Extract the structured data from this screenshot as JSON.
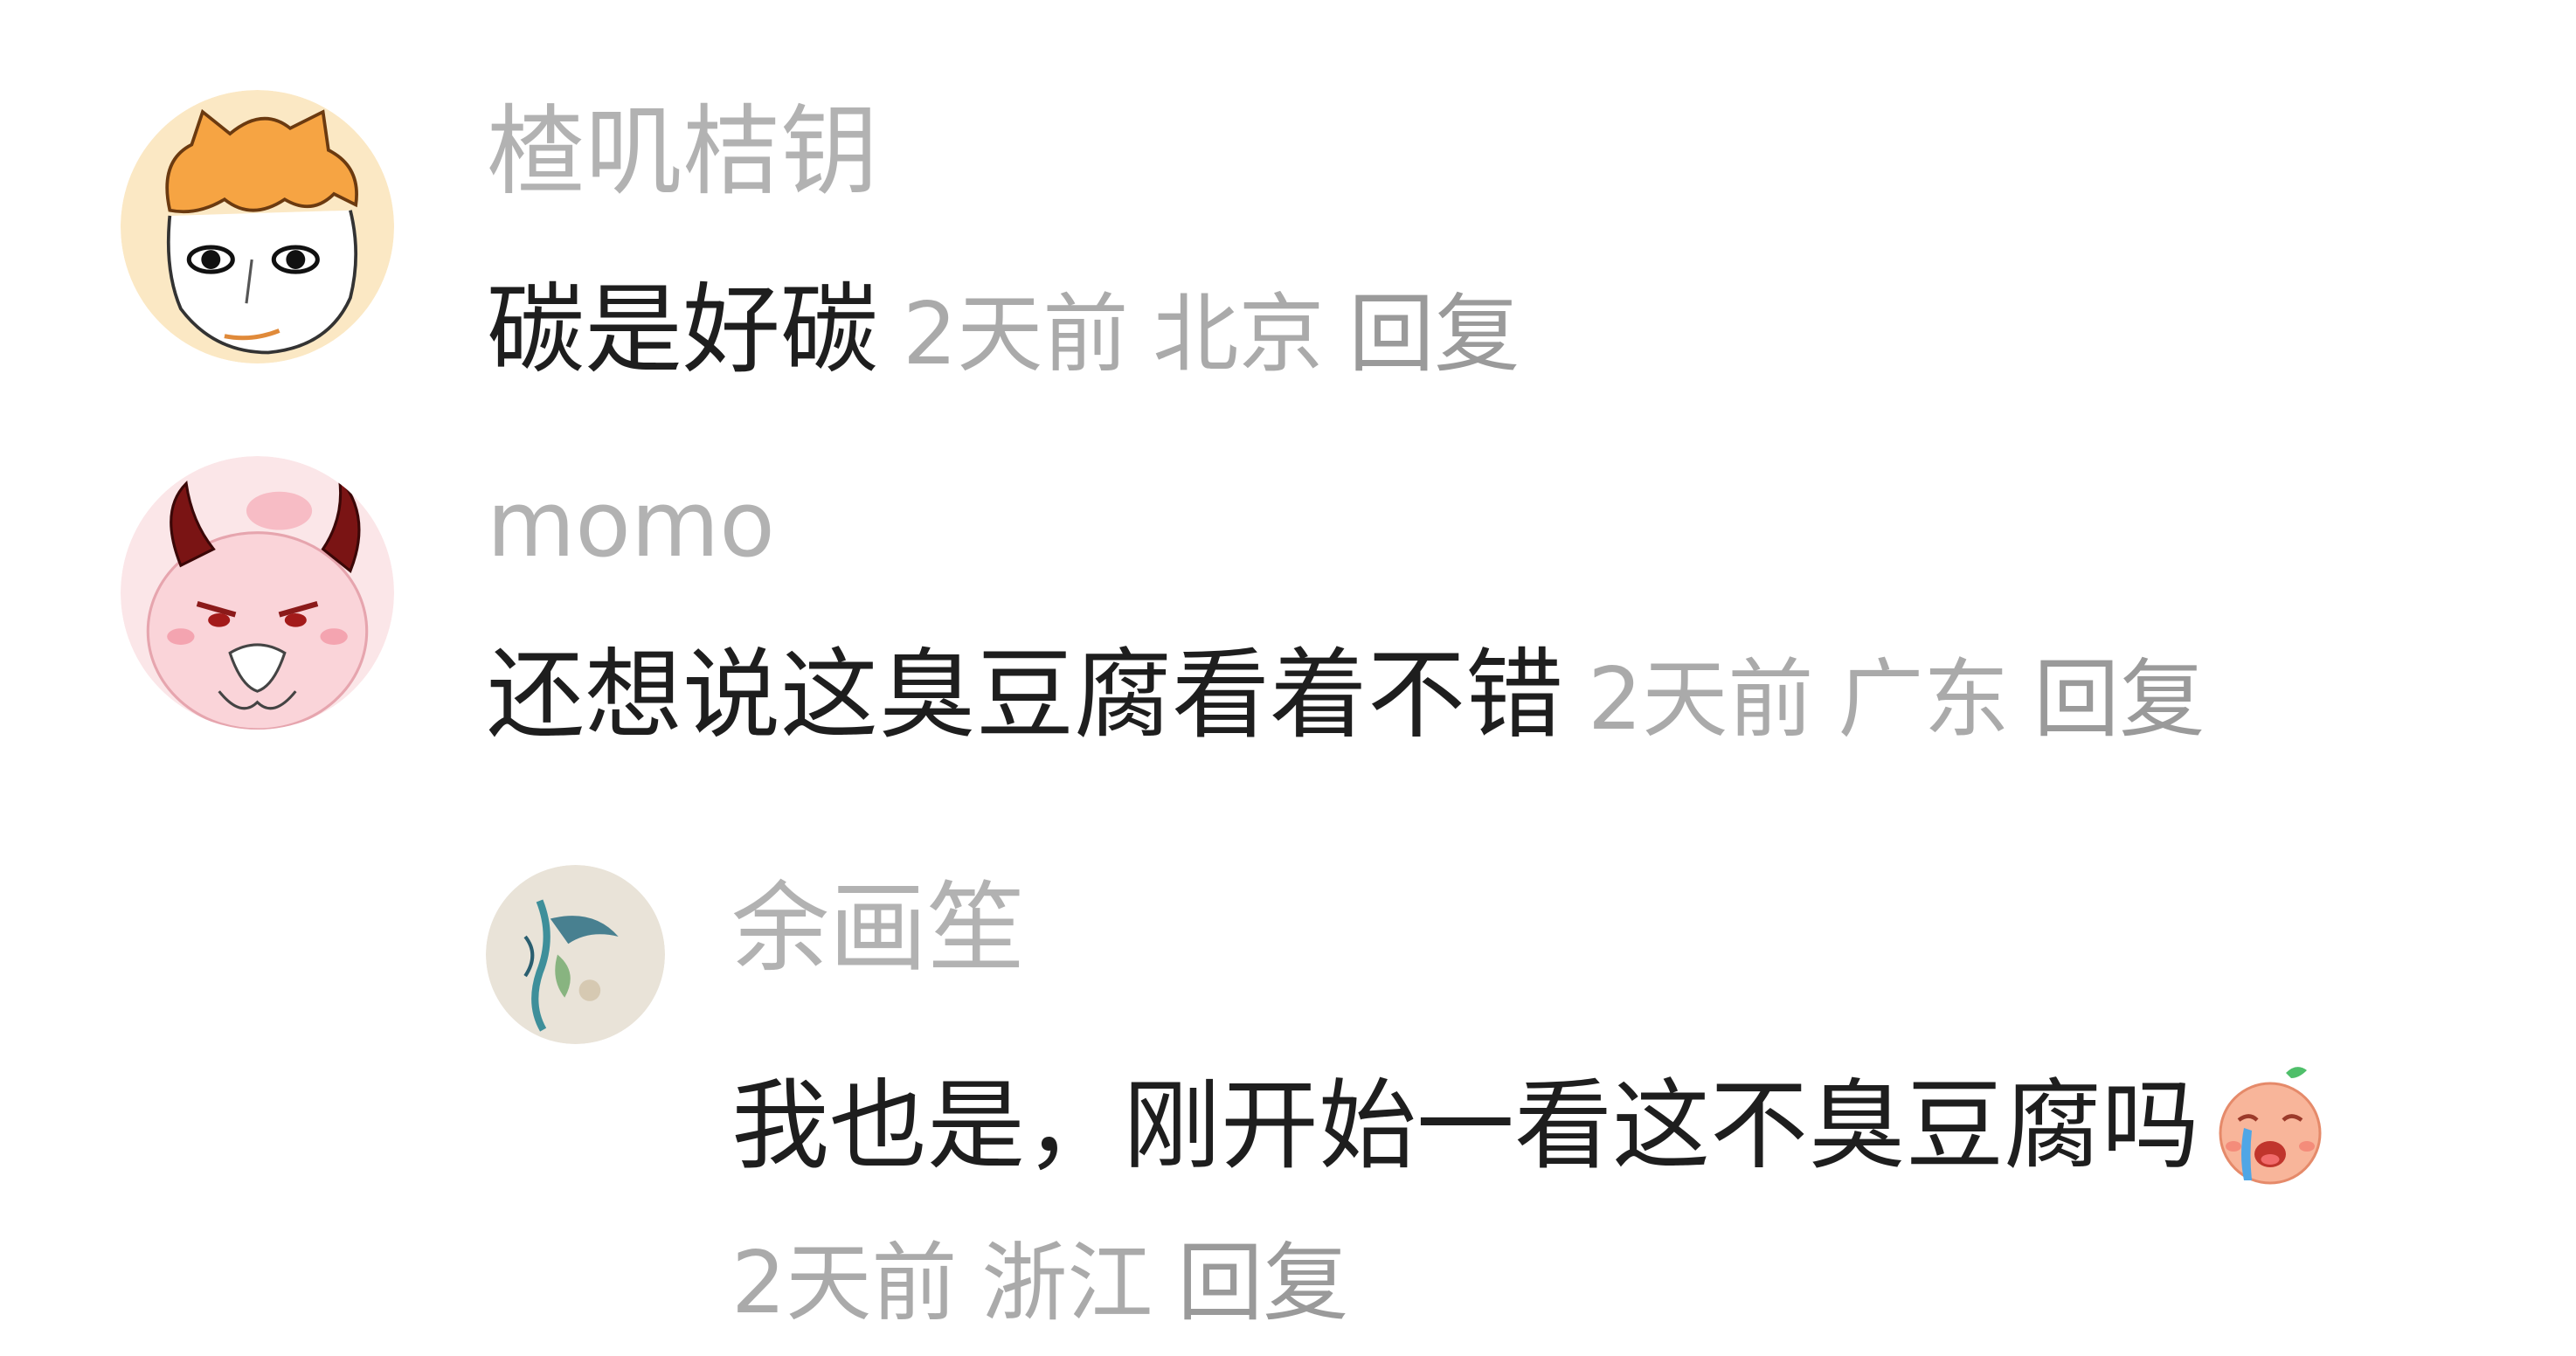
{
  "comments": [
    {
      "username": "楂叽桔钥",
      "avatar_icon": "orange-hair-cartoon-face-avatar",
      "text": "碳是好碳",
      "time": "2天前",
      "location": "北京",
      "reply_label": "回复"
    },
    {
      "username": "momo",
      "avatar_icon": "pink-devil-horn-cartoon-avatar",
      "text": "还想说这臭豆腐看着不错",
      "time": "2天前",
      "location": "广东",
      "reply_label": "回复"
    }
  ],
  "reply": {
    "username": "余画笙",
    "avatar_icon": "watercolor-sketch-avatar",
    "text": "我也是，刚开始一看这不臭豆腐吗",
    "emoji_icon": "crying-face-emoji",
    "time": "2天前",
    "location": "浙江",
    "reply_label": "回复"
  },
  "colors": {
    "username": "#b2b2b2",
    "content": "#1e1e1e",
    "meta": "#aaaaaa",
    "reply": "#9a9a9a"
  }
}
